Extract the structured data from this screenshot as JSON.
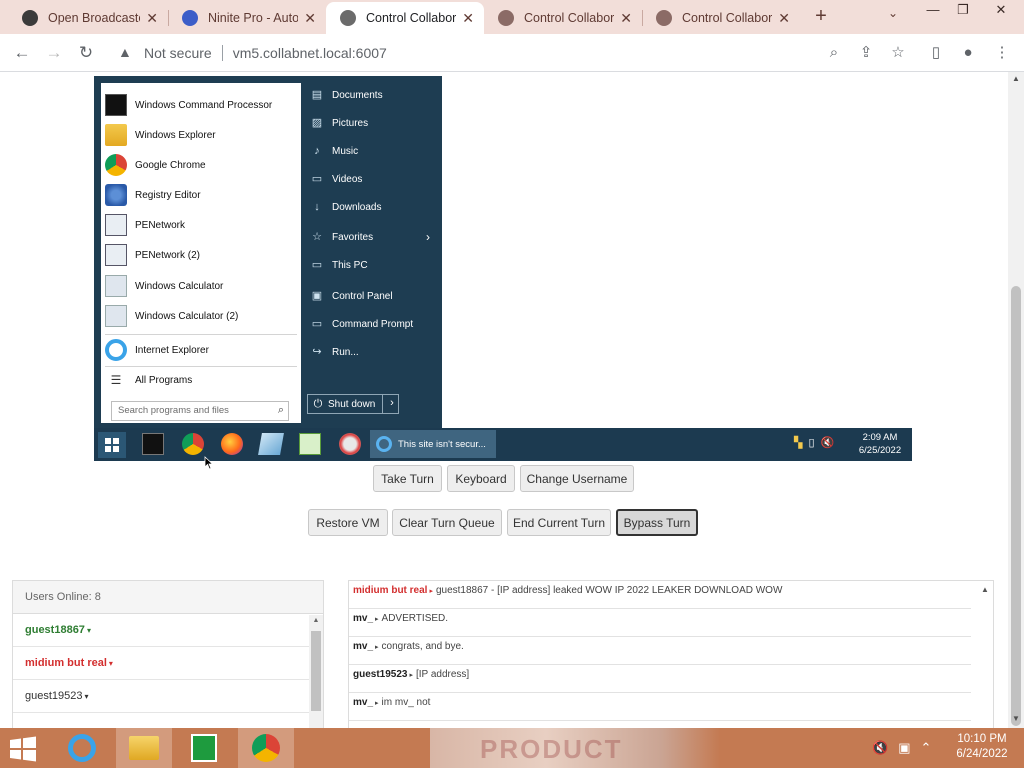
{
  "browser": {
    "tabs": [
      {
        "title": "Open Broadcaster",
        "favicon_color": "#3b3b3b",
        "active": false
      },
      {
        "title": "Ninite Pro - Auto",
        "favicon_color": "#3c5dc8",
        "active": false
      },
      {
        "title": "Control Collabora",
        "favicon_color": "#6b6b6b",
        "active": true
      },
      {
        "title": "Control Collabora",
        "favicon_color": "#8b6b66",
        "active": false
      },
      {
        "title": "Control Collabora",
        "favicon_color": "#8b6b66",
        "active": false
      }
    ],
    "new_tab": "+",
    "tab_search": "⌄",
    "window_controls": {
      "minimize": "—",
      "restore": "❐",
      "close": "✕"
    },
    "address": {
      "security_label": "Not secure",
      "url": "vm5.collabnet.local:6007"
    },
    "nav": {
      "back": "←",
      "forward": "→",
      "reload": "↻"
    }
  },
  "vm": {
    "start_menu": {
      "programs": [
        {
          "label": "Windows Command Processor",
          "icon": "cmd-icon"
        },
        {
          "label": "Windows Explorer",
          "icon": "folder-icon"
        },
        {
          "label": "Google Chrome",
          "icon": "chrome-icon"
        },
        {
          "label": "Registry Editor",
          "icon": "registry-icon"
        },
        {
          "label": "PENetwork",
          "icon": "network-icon"
        },
        {
          "label": "PENetwork (2)",
          "icon": "network-icon"
        },
        {
          "label": "Windows Calculator",
          "icon": "calculator-icon"
        },
        {
          "label": "Windows Calculator (2)",
          "icon": "calculator-icon"
        },
        {
          "label": "Internet Explorer",
          "icon": "ie-icon"
        }
      ],
      "all_programs": "All Programs",
      "search_placeholder": "Search programs and files",
      "places": [
        {
          "label": "Documents",
          "glyph": "▤"
        },
        {
          "label": "Pictures",
          "glyph": "▨"
        },
        {
          "label": "Music",
          "glyph": "♪"
        },
        {
          "label": "Videos",
          "glyph": "▭"
        },
        {
          "label": "Downloads",
          "glyph": "↓"
        },
        {
          "label": "Favorites",
          "glyph": "☆"
        },
        {
          "label": "This PC",
          "glyph": "▭"
        },
        {
          "label": "Control Panel",
          "glyph": "▣"
        },
        {
          "label": "Command Prompt",
          "glyph": "▭"
        },
        {
          "label": "Run...",
          "glyph": "↪"
        }
      ],
      "favorites_arrow": "›",
      "shutdown_label": "Shut down",
      "shutdown_more": "›"
    },
    "taskbar": {
      "window_title": "This site isn't secur...",
      "clock_time": "2:09 AM",
      "clock_date": "6/25/2022"
    }
  },
  "controls": {
    "row1": [
      "Take Turn",
      "Keyboard",
      "Change Username"
    ],
    "row2": [
      "Restore VM",
      "Clear Turn Queue",
      "End Current Turn",
      "Bypass Turn"
    ]
  },
  "users": {
    "header": "Users Online: 8",
    "list": [
      {
        "name": "guest18867",
        "color": "#2e7d32"
      },
      {
        "name": "midium but real",
        "color": "#d32f2f"
      },
      {
        "name": "guest19523",
        "color": "#333333"
      }
    ],
    "caret": "▾"
  },
  "chat": {
    "messages": [
      {
        "user": "midium but real",
        "color": "#d32f2f",
        "text": "guest18867 - [IP address] leaked WOW IP 2022 LEAKER DOWNLOAD WOW"
      },
      {
        "user": "mv_",
        "color": "#222222",
        "text": "ADVERTISED."
      },
      {
        "user": "mv_",
        "color": "#222222",
        "text": "congrats, and bye."
      },
      {
        "user": "guest19523",
        "color": "#222222",
        "text": "[IP address]"
      },
      {
        "user": "mv_",
        "color": "#222222",
        "text": "im mv_ not"
      }
    ],
    "separator": "▸",
    "scroll_up": "▲"
  },
  "host_taskbar": {
    "clock_time": "10:10 PM",
    "clock_date": "6/24/2022",
    "wallpaper_text": "PRODUCT"
  }
}
